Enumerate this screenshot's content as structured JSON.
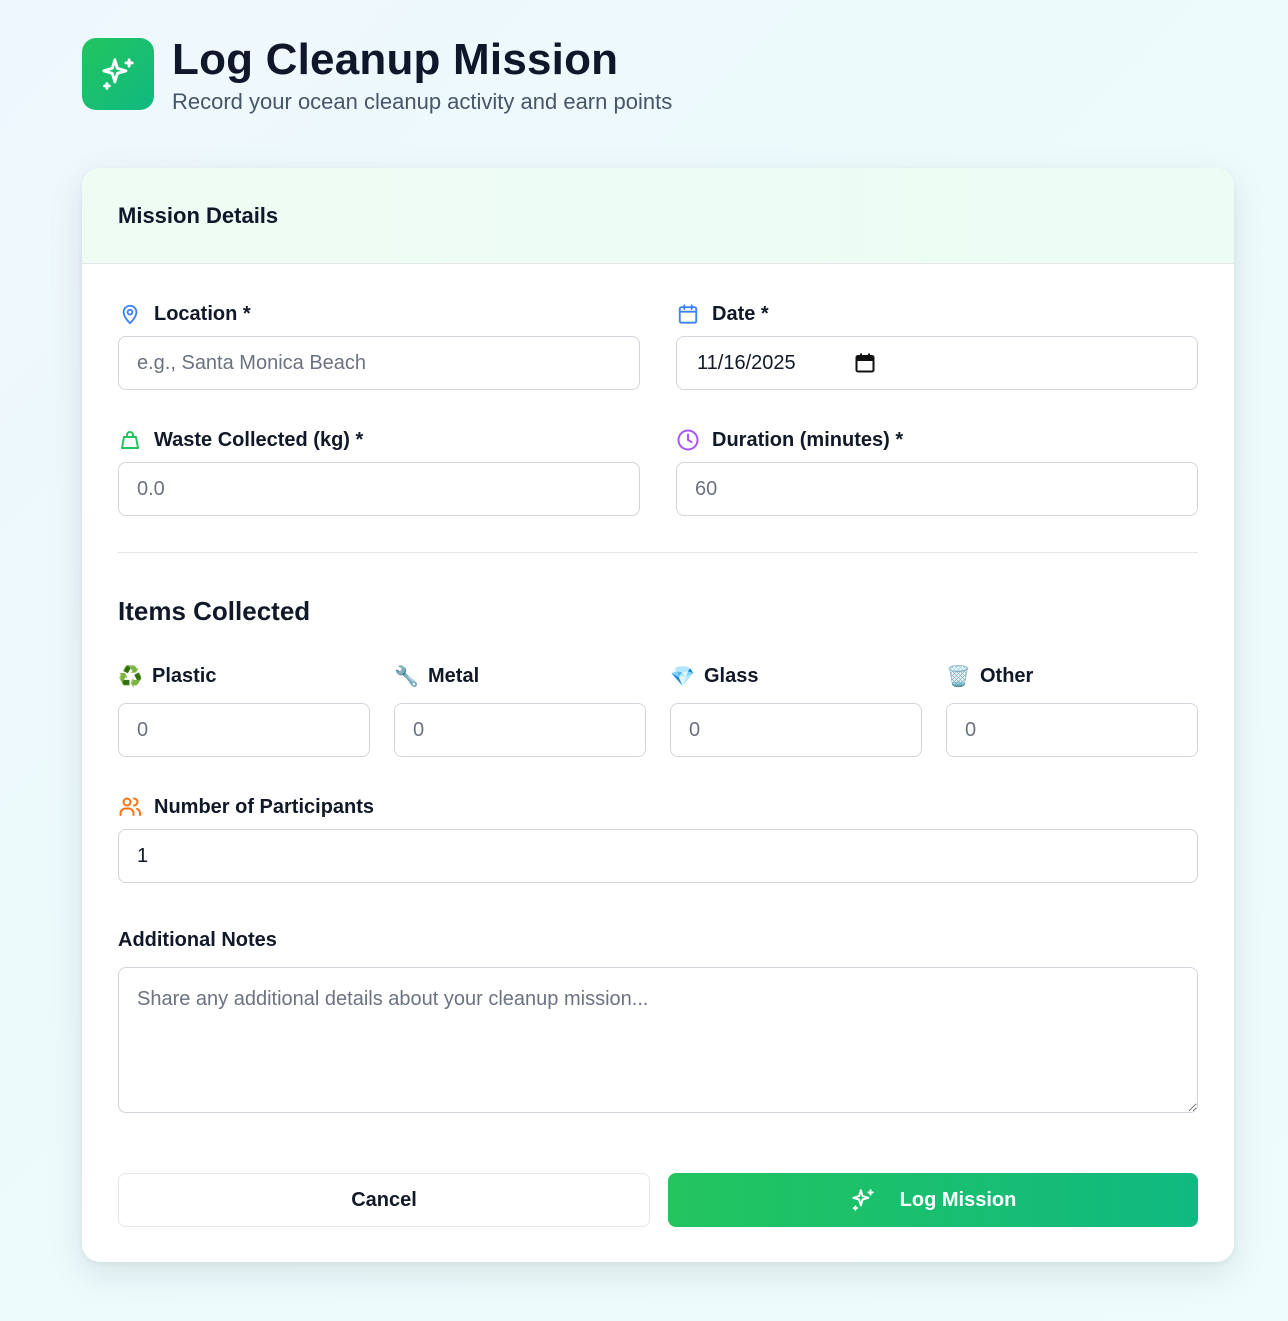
{
  "header": {
    "title": "Log Cleanup Mission",
    "subtitle": "Record your ocean cleanup activity and earn points",
    "logo_icon": "sparkles-icon"
  },
  "card": {
    "title": "Mission Details"
  },
  "fields": {
    "location": {
      "label": "Location *",
      "placeholder": "e.g., Santa Monica Beach",
      "value": "",
      "icon": "map-pin-icon",
      "color": "#3b82f6"
    },
    "date": {
      "label": "Date *",
      "value": "11/16/2025",
      "icon": "calendar-icon",
      "color": "#3b82f6"
    },
    "waste": {
      "label": "Waste Collected (kg) *",
      "placeholder": "0.0",
      "value": "",
      "icon": "shopping-bag-icon",
      "color": "#22c55e"
    },
    "duration": {
      "label": "Duration (minutes) *",
      "placeholder": "60",
      "value": "",
      "icon": "clock-icon",
      "color": "#a855f7"
    },
    "participants": {
      "label": "Number of Participants",
      "value": "1",
      "icon": "users-icon",
      "color": "#f97316"
    },
    "notes": {
      "label": "Additional Notes",
      "placeholder": "Share any additional details about your cleanup mission..."
    }
  },
  "items": {
    "title": "Items Collected",
    "list": [
      {
        "label": "Plastic",
        "emoji": "♻️",
        "icon": "recycle-icon",
        "placeholder": "0"
      },
      {
        "label": "Metal",
        "emoji": "🔧",
        "icon": "wrench-icon",
        "placeholder": "0"
      },
      {
        "label": "Glass",
        "emoji": "💎",
        "icon": "gem-icon",
        "placeholder": "0"
      },
      {
        "label": "Other",
        "emoji": "🗑️",
        "icon": "trash-icon",
        "placeholder": "0"
      }
    ]
  },
  "actions": {
    "cancel_label": "Cancel",
    "submit_label": "Log Mission",
    "submit_icon": "sparkles-icon"
  },
  "colors": {
    "accent_start": "#22c55e",
    "accent_end": "#10b981"
  }
}
